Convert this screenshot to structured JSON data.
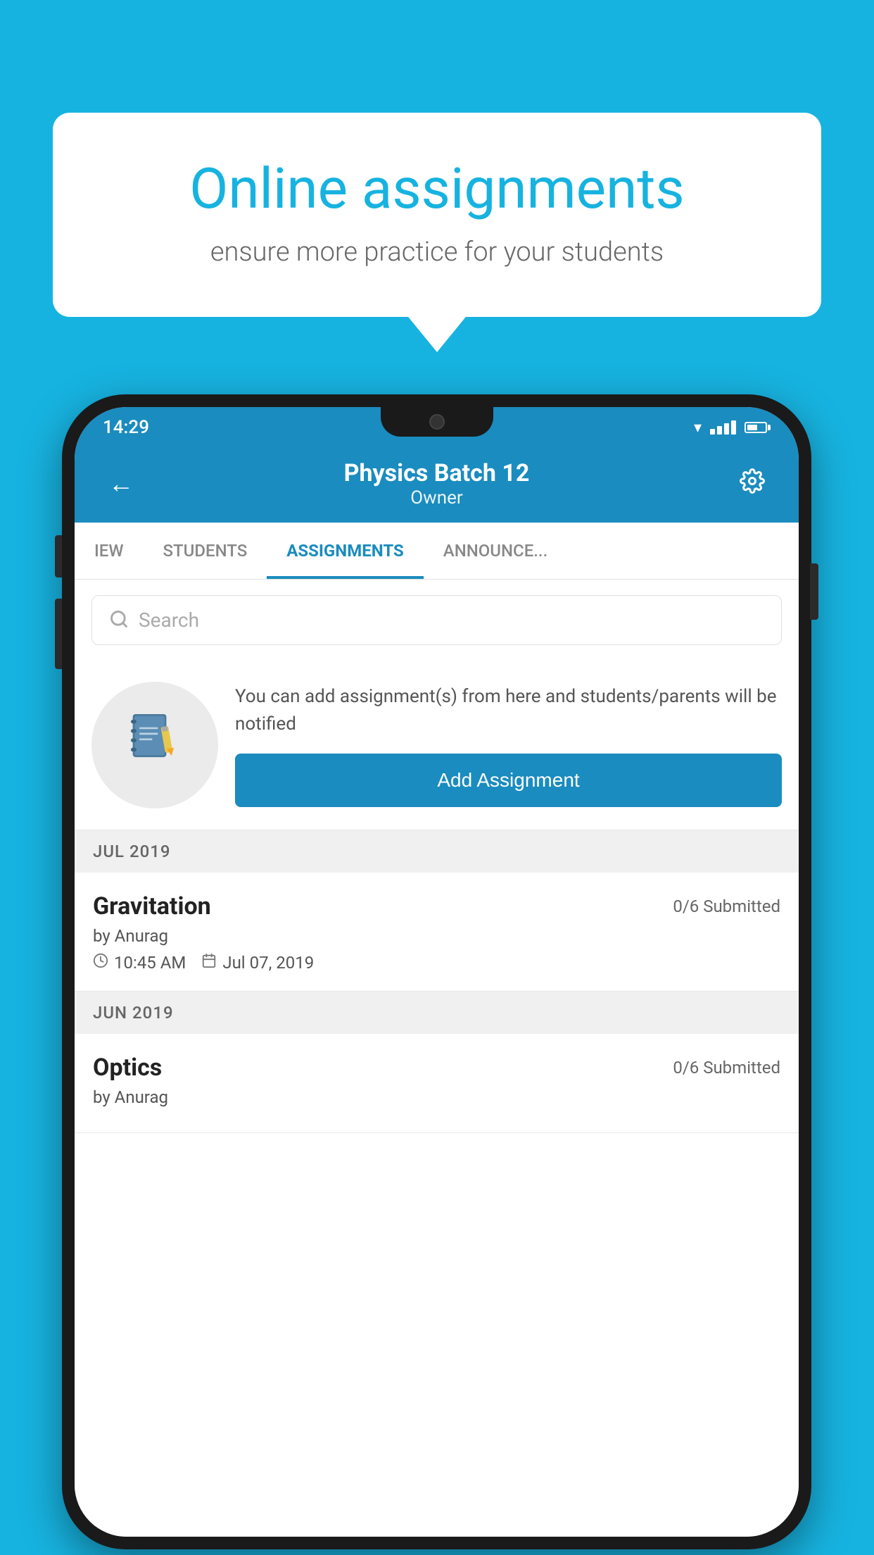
{
  "background_color": "#17b3e0",
  "speech_bubble": {
    "title": "Online assignments",
    "subtitle": "ensure more practice for your students"
  },
  "status_bar": {
    "time": "14:29"
  },
  "header": {
    "back_label": "←",
    "title": "Physics Batch 12",
    "subtitle": "Owner",
    "settings_label": "⚙"
  },
  "tabs": [
    {
      "label": "IEW",
      "active": false
    },
    {
      "label": "STUDENTS",
      "active": false
    },
    {
      "label": "ASSIGNMENTS",
      "active": true
    },
    {
      "label": "ANNOUNCEMENTS",
      "active": false
    }
  ],
  "search": {
    "placeholder": "Search"
  },
  "add_assignment_section": {
    "description": "You can add assignment(s) from here and students/parents will be notified",
    "button_label": "Add Assignment"
  },
  "sections": [
    {
      "header": "JUL 2019",
      "assignments": [
        {
          "name": "Gravitation",
          "submitted": "0/6 Submitted",
          "author": "by Anurag",
          "time": "10:45 AM",
          "date": "Jul 07, 2019"
        }
      ]
    },
    {
      "header": "JUN 2019",
      "assignments": [
        {
          "name": "Optics",
          "submitted": "0/6 Submitted",
          "author": "by Anurag",
          "time": "",
          "date": ""
        }
      ]
    }
  ]
}
